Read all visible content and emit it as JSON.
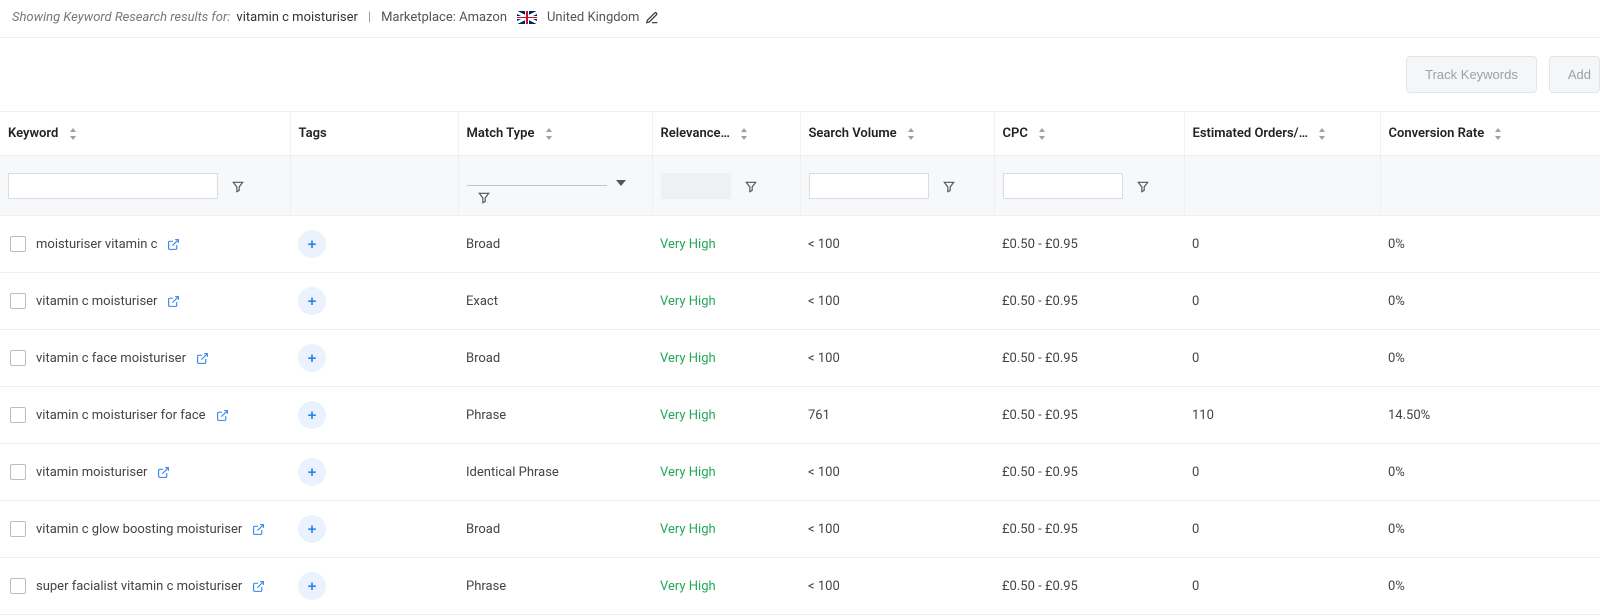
{
  "header": {
    "prefix": "Showing Keyword Research results for:",
    "term": "vitamin c moisturiser",
    "marketplace_label": "Marketplace: Amazon",
    "country": "United Kingdom"
  },
  "actions": {
    "track": "Track Keywords",
    "add": "Add"
  },
  "columns": {
    "keyword": "Keyword",
    "tags": "Tags",
    "match": "Match Type",
    "relevance": "Relevance…",
    "volume": "Search Volume",
    "cpc": "CPC",
    "orders": "Estimated Orders/…",
    "conversion": "Conversion Rate"
  },
  "rows": [
    {
      "keyword": "moisturiser vitamin c",
      "match": "Broad",
      "relevance": "Very High",
      "volume": "< 100",
      "cpc": "£0.50 - £0.95",
      "orders": "0",
      "conversion": "0%"
    },
    {
      "keyword": "vitamin c moisturiser",
      "match": "Exact",
      "relevance": "Very High",
      "volume": "< 100",
      "cpc": "£0.50 - £0.95",
      "orders": "0",
      "conversion": "0%"
    },
    {
      "keyword": "vitamin c face moisturiser",
      "match": "Broad",
      "relevance": "Very High",
      "volume": "< 100",
      "cpc": "£0.50 - £0.95",
      "orders": "0",
      "conversion": "0%"
    },
    {
      "keyword": "vitamin c moisturiser for face",
      "match": "Phrase",
      "relevance": "Very High",
      "volume": "761",
      "cpc": "£0.50 - £0.95",
      "orders": "110",
      "conversion": "14.50%"
    },
    {
      "keyword": "vitamin moisturiser",
      "match": "Identical Phrase",
      "relevance": "Very High",
      "volume": "< 100",
      "cpc": "£0.50 - £0.95",
      "orders": "0",
      "conversion": "0%"
    },
    {
      "keyword": "vitamin c glow boosting moisturiser",
      "match": "Broad",
      "relevance": "Very High",
      "volume": "< 100",
      "cpc": "£0.50 - £0.95",
      "orders": "0",
      "conversion": "0%"
    },
    {
      "keyword": "super facialist vitamin c moisturiser",
      "match": "Phrase",
      "relevance": "Very High",
      "volume": "< 100",
      "cpc": "£0.50 - £0.95",
      "orders": "0",
      "conversion": "0%"
    }
  ],
  "colors": {
    "link": "#2f80ed",
    "relevance_high": "#25a75a"
  }
}
